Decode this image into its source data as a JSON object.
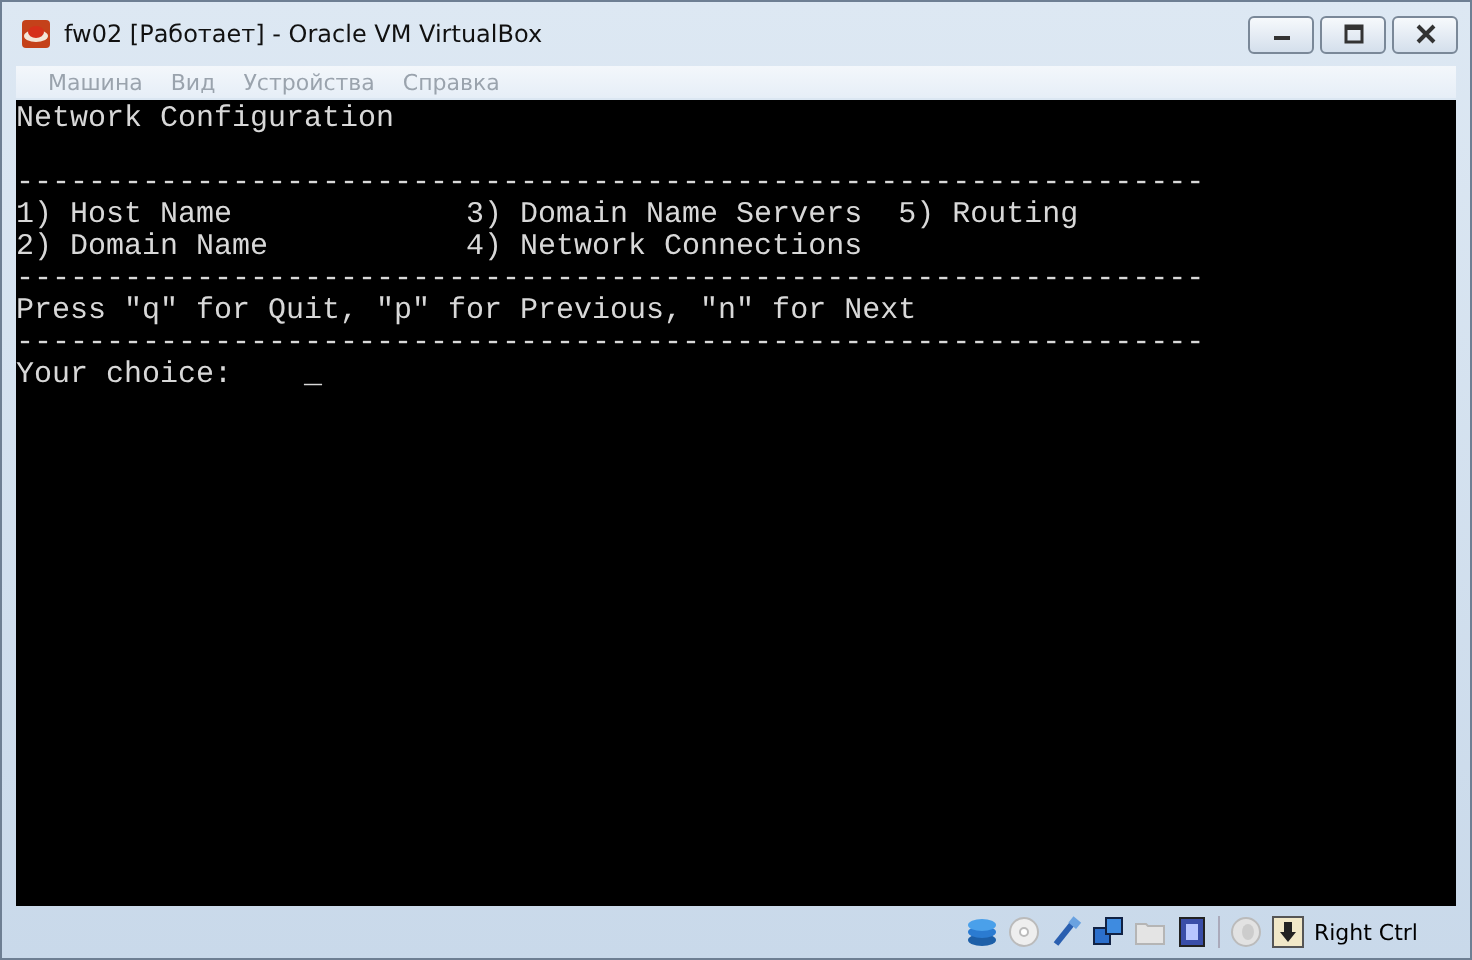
{
  "window": {
    "title": "fw02 [Работает] - Oracle VM VirtualBox"
  },
  "menu": [
    {
      "label": "Машина",
      "disabled": true
    },
    {
      "label": "Вид",
      "disabled": true
    },
    {
      "label": "Устройства",
      "disabled": true
    },
    {
      "label": "Справка",
      "disabled": true
    }
  ],
  "console": {
    "lines": [
      "Network Configuration",
      "------------------------------------------------------------------",
      "1) Host Name             3) Domain Name Servers  5) Routing",
      "2) Domain Name           4) Network Connections",
      "------------------------------------------------------------------",
      "Press \"q\" for Quit, \"p\" for Previous, \"n\" for Next",
      "------------------------------------------------------------------",
      "Your choice:    _"
    ]
  },
  "status_bar": {
    "host_key": "Right Ctrl"
  }
}
